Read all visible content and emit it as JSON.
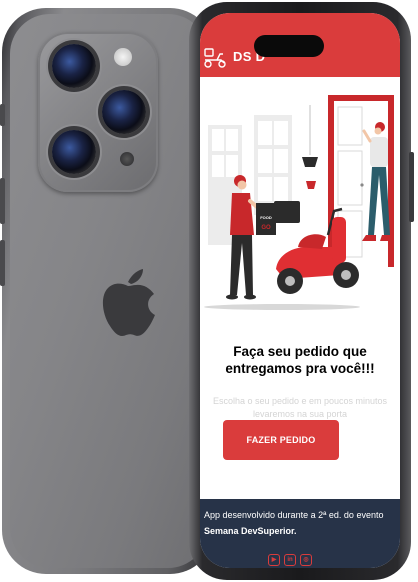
{
  "app": {
    "brand": "DS D",
    "brand_icon": "delivery-scooter-icon",
    "accent_color": "#da3c3c",
    "footer_color": "#273348"
  },
  "hero": {
    "illustration": "delivery-scene-illustration",
    "box_label_top": "FOOD",
    "box_label_bottom": "GO"
  },
  "main": {
    "headline_line1": "Faça seu pedido que",
    "headline_line2": "entregamos pra você!!!",
    "subtitle_line1": "Escolha o seu pedido e em poucos minutos",
    "subtitle_line2": "levaremos na sua porta",
    "cta_label": "FAZER PEDIDO"
  },
  "footer": {
    "text_prefix": "App desenvolvido durante a 2ª ed. do evento",
    "text_bold": "Semana DevSuperior.",
    "social": [
      {
        "name": "youtube-icon",
        "glyph": "▶"
      },
      {
        "name": "linkedin-icon",
        "glyph": "in"
      },
      {
        "name": "instagram-icon",
        "glyph": "◎"
      }
    ]
  }
}
